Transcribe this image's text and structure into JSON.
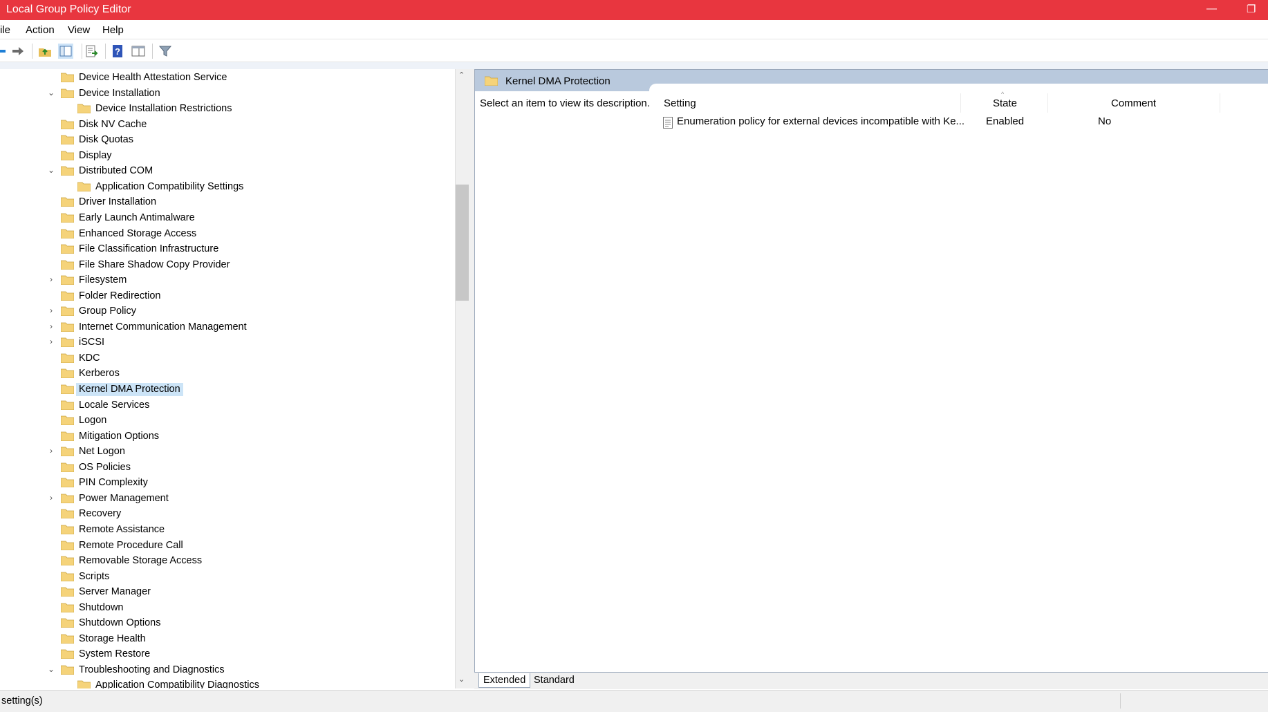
{
  "window": {
    "title": "Local Group Policy Editor"
  },
  "menu": [
    "File",
    "Action",
    "View",
    "Help"
  ],
  "menu_visible": [
    "ile",
    "Action",
    "View",
    "Help"
  ],
  "tree": {
    "items": [
      {
        "label": "Device Health Attestation Service",
        "level": 1,
        "expander": "none"
      },
      {
        "label": "Device Installation",
        "level": 1,
        "expander": "expanded"
      },
      {
        "label": "Device Installation Restrictions",
        "level": 2,
        "expander": "none"
      },
      {
        "label": "Disk NV Cache",
        "level": 1,
        "expander": "none"
      },
      {
        "label": "Disk Quotas",
        "level": 1,
        "expander": "none"
      },
      {
        "label": "Display",
        "level": 1,
        "expander": "none"
      },
      {
        "label": "Distributed COM",
        "level": 1,
        "expander": "expanded"
      },
      {
        "label": "Application Compatibility Settings",
        "level": 2,
        "expander": "none"
      },
      {
        "label": "Driver Installation",
        "level": 1,
        "expander": "none"
      },
      {
        "label": "Early Launch Antimalware",
        "level": 1,
        "expander": "none"
      },
      {
        "label": "Enhanced Storage Access",
        "level": 1,
        "expander": "none"
      },
      {
        "label": "File Classification Infrastructure",
        "level": 1,
        "expander": "none"
      },
      {
        "label": "File Share Shadow Copy Provider",
        "level": 1,
        "expander": "none"
      },
      {
        "label": "Filesystem",
        "level": 1,
        "expander": "collapsed"
      },
      {
        "label": "Folder Redirection",
        "level": 1,
        "expander": "none"
      },
      {
        "label": "Group Policy",
        "level": 1,
        "expander": "collapsed"
      },
      {
        "label": "Internet Communication Management",
        "level": 1,
        "expander": "collapsed"
      },
      {
        "label": "iSCSI",
        "level": 1,
        "expander": "collapsed"
      },
      {
        "label": "KDC",
        "level": 1,
        "expander": "none"
      },
      {
        "label": "Kerberos",
        "level": 1,
        "expander": "none"
      },
      {
        "label": "Kernel DMA Protection",
        "level": 1,
        "expander": "none",
        "selected": true
      },
      {
        "label": "Locale Services",
        "level": 1,
        "expander": "none"
      },
      {
        "label": "Logon",
        "level": 1,
        "expander": "none"
      },
      {
        "label": "Mitigation Options",
        "level": 1,
        "expander": "none"
      },
      {
        "label": "Net Logon",
        "level": 1,
        "expander": "collapsed"
      },
      {
        "label": "OS Policies",
        "level": 1,
        "expander": "none"
      },
      {
        "label": "PIN Complexity",
        "level": 1,
        "expander": "none"
      },
      {
        "label": "Power Management",
        "level": 1,
        "expander": "collapsed"
      },
      {
        "label": "Recovery",
        "level": 1,
        "expander": "none"
      },
      {
        "label": "Remote Assistance",
        "level": 1,
        "expander": "none"
      },
      {
        "label": "Remote Procedure Call",
        "level": 1,
        "expander": "none"
      },
      {
        "label": "Removable Storage Access",
        "level": 1,
        "expander": "none"
      },
      {
        "label": "Scripts",
        "level": 1,
        "expander": "none"
      },
      {
        "label": "Server Manager",
        "level": 1,
        "expander": "none"
      },
      {
        "label": "Shutdown",
        "level": 1,
        "expander": "none"
      },
      {
        "label": "Shutdown Options",
        "level": 1,
        "expander": "none"
      },
      {
        "label": "Storage Health",
        "level": 1,
        "expander": "none"
      },
      {
        "label": "System Restore",
        "level": 1,
        "expander": "none"
      },
      {
        "label": "Troubleshooting and Diagnostics",
        "level": 1,
        "expander": "expanded"
      },
      {
        "label": "Application Compatibility Diagnostics",
        "level": 2,
        "expander": "none"
      }
    ]
  },
  "right": {
    "header_title": "Kernel DMA Protection",
    "description": "Select an item to view its description.",
    "columns": {
      "setting": "Setting",
      "state": "State",
      "comment": "Comment"
    },
    "rows": [
      {
        "setting": "Enumeration policy for external devices incompatible with Ke...",
        "state": "Enabled",
        "comment": "No"
      }
    ]
  },
  "tabs": {
    "extended": "Extended",
    "standard": "Standard"
  },
  "status": {
    "text": "setting(s)"
  },
  "colors": {
    "titlebar": "#e8363f",
    "selection": "#cce4f7",
    "header": "#b9c9dd",
    "folder": "#f5d37a"
  },
  "icons": [
    "back-arrow-icon",
    "forward-arrow-icon",
    "up-folder-icon",
    "show-hide-tree-icon",
    "export-list-icon",
    "help-icon",
    "show-hide-action-pane-icon",
    "filter-icon",
    "folder-icon",
    "setting-page-icon",
    "chevron-down-icon",
    "chevron-right-icon",
    "minimize-icon",
    "restore-icon"
  ]
}
